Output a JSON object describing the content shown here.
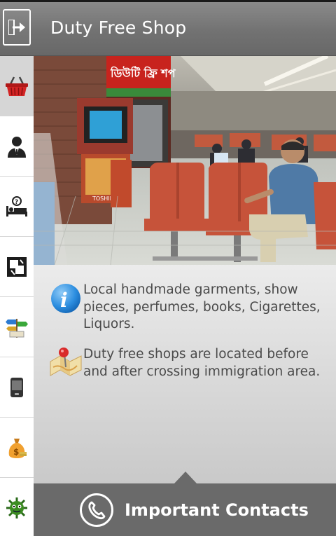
{
  "header": {
    "title": "Duty Free Shop"
  },
  "sidebar": {
    "items": [
      {
        "name": "shopping-basket-icon",
        "active": true
      },
      {
        "name": "officer-icon",
        "active": false
      },
      {
        "name": "lodging-question-icon",
        "active": false
      },
      {
        "name": "currency-exchange-icon",
        "active": false
      },
      {
        "name": "directions-sign-icon",
        "active": false
      },
      {
        "name": "mobile-phone-icon",
        "active": false
      },
      {
        "name": "money-bag-icon",
        "active": false
      },
      {
        "name": "virus-icon",
        "active": false
      }
    ]
  },
  "photo": {
    "sign_text": "ডিউটি ফ্রি শপ",
    "brand_text": "TOSHIBA"
  },
  "info": [
    {
      "icon": "info-icon",
      "text": "Local handmade garments, show pieces, perfumes, books, Cigarettes, Liquors."
    },
    {
      "icon": "map-pin-icon",
      "text": "Duty free shops are located before and after crossing immigration area."
    }
  ],
  "footer": {
    "label": "Important Contacts",
    "icon": "phone-icon"
  }
}
